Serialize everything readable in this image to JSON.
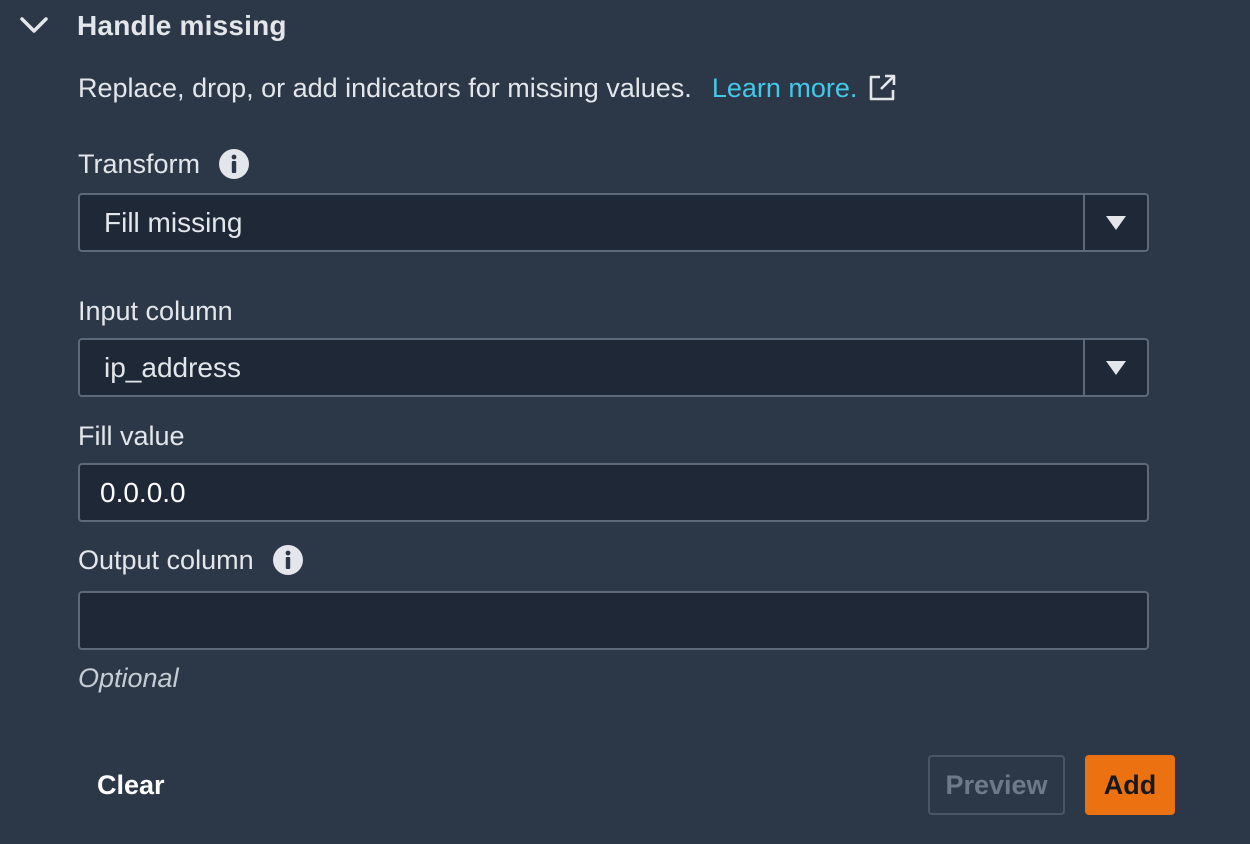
{
  "section": {
    "title": "Handle missing",
    "description": "Replace, drop, or add indicators for missing values.",
    "learn_more": "Learn more."
  },
  "fields": {
    "transform": {
      "label": "Transform",
      "value": "Fill missing"
    },
    "input_column": {
      "label": "Input column",
      "value": "ip_address"
    },
    "fill_value": {
      "label": "Fill value",
      "value": "0.0.0.0"
    },
    "output_column": {
      "label": "Output column",
      "value": "",
      "hint": "Optional"
    }
  },
  "actions": {
    "clear": "Clear",
    "preview": "Preview",
    "add": "Add"
  },
  "colors": {
    "background": "#2c3748",
    "input_background": "#1f2836",
    "border": "#5d6878",
    "link": "#44c8e8",
    "primary": "#ec7211"
  },
  "icons": {
    "collapse": "chevron-down-icon",
    "external_link": "external-link-icon",
    "info": "info-icon",
    "dropdown": "caret-down-icon"
  }
}
